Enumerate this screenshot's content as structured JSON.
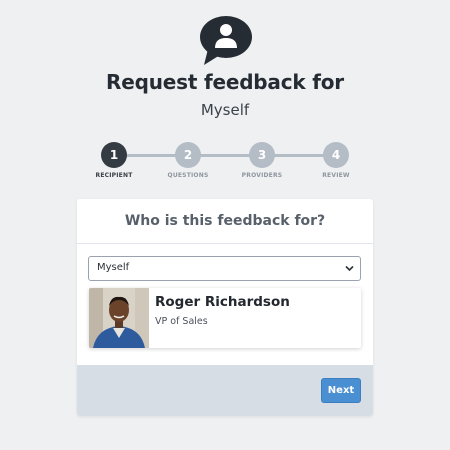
{
  "header": {
    "icon": "feedback-user-icon",
    "title": "Request feedback for",
    "subtitle": "Myself"
  },
  "stepper": {
    "current_step": 1,
    "steps": [
      {
        "number": "1",
        "label": "RECIPIENT"
      },
      {
        "number": "2",
        "label": "QUESTIONS"
      },
      {
        "number": "3",
        "label": "PROVIDERS"
      },
      {
        "number": "4",
        "label": "REVIEW"
      }
    ]
  },
  "card": {
    "title": "Who is this feedback for?",
    "select": {
      "value": "Myself",
      "icon": "chevron-down-icon"
    },
    "person": {
      "name": "Roger Richardson",
      "role": "VP of Sales"
    },
    "next_label": "Next"
  },
  "colors": {
    "background": "#eff0f2",
    "active_step": "#353b43",
    "inactive_step": "#b4bcc6",
    "primary_button": "#4a8fd1",
    "footer": "#d7dde4"
  }
}
